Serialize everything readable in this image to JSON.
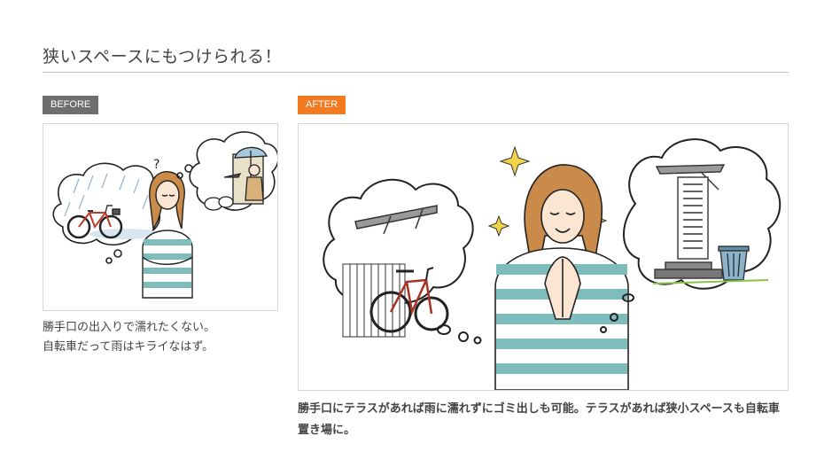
{
  "section": {
    "title": "狭いスペースにもつけられる！"
  },
  "before": {
    "badge": "BEFORE",
    "caption_lines": [
      "勝手口の出入りで濡れたくない。",
      "自転車だって雨はキライなはず。"
    ]
  },
  "after": {
    "badge": "AFTER",
    "caption": "勝手口にテラスがあれば雨に濡れずにゴミ出しも可能。テラスがあれば狭小スペースも自転車置き場に。"
  },
  "colors": {
    "before_badge": "#6e6e6e",
    "after_badge": "#f47a1f",
    "rule": "#bfbfbf"
  }
}
